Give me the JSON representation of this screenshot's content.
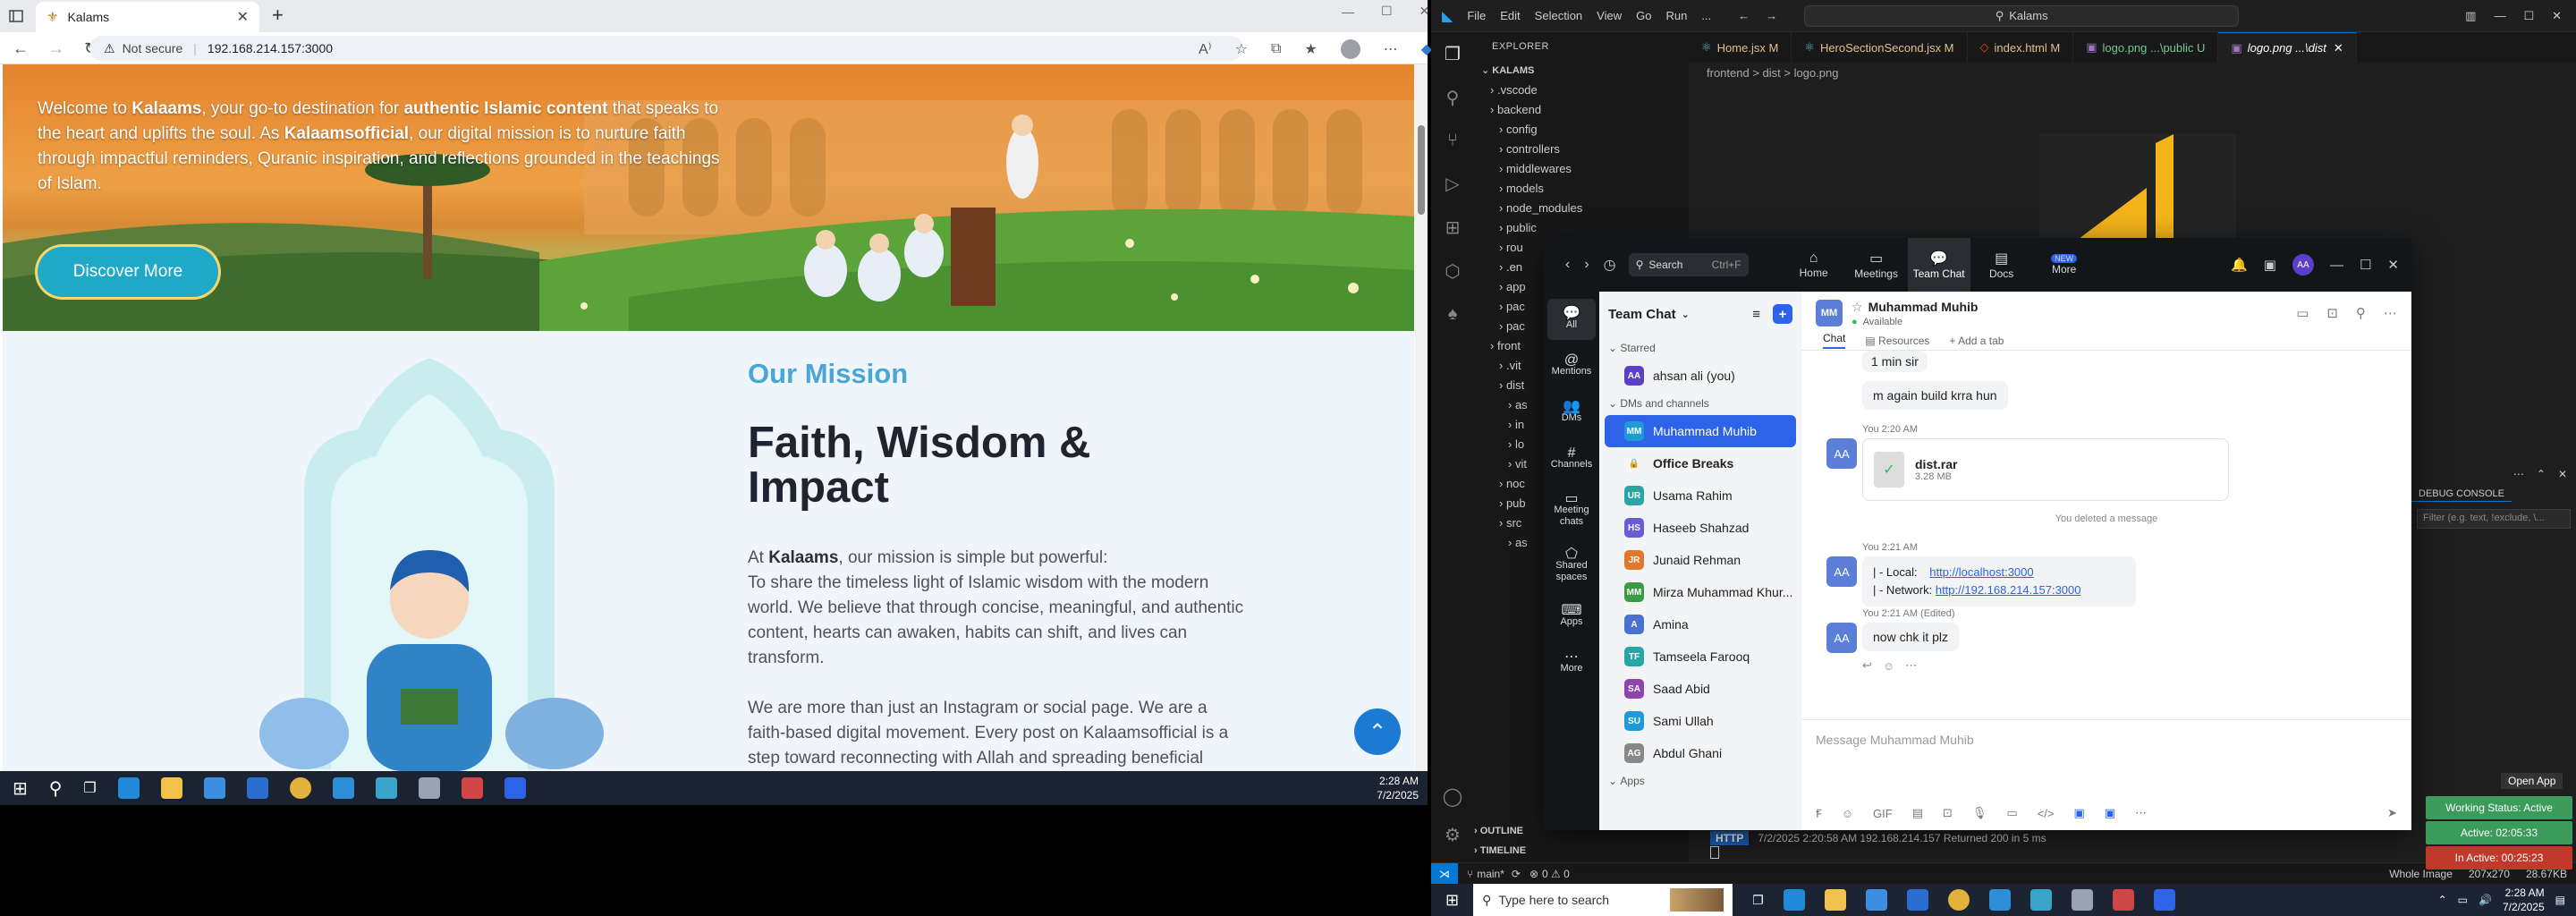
{
  "browser": {
    "tab_title": "Kalams",
    "security": "Not secure",
    "url": "192.168.214.157:3000"
  },
  "hero": {
    "text_pre": "Welcome to ",
    "text_b1": "Kalaams",
    "text_mid": ", your go-to destination for ",
    "text_b2": "authentic Islamic content",
    "text_mid2": " that speaks to the heart and uplifts the soul. As ",
    "text_b3": "Kalaamsofficial",
    "text_post": ", our digital mission is to nurture faith through impactful reminders, Quranic inspiration, and reflections grounded in the teachings of Islam.",
    "button": "Discover More"
  },
  "mission": {
    "label": "Our Mission",
    "title": "Faith, Wisdom & Impact",
    "p1_pre": "At ",
    "p1_b": "Kalaams",
    "p1_post": ", our mission is simple but powerful:",
    "p1_line2": "To share the timeless light of Islamic wisdom with the modern world. We believe that through concise, meaningful, and authentic content, hearts can awaken, habits can shift, and lives can transform.",
    "p2": "We are more than just an Instagram or social page. We are a faith-based digital movement. Every post on Kalaamsofficial is a step toward reconnecting with Allah and spreading beneficial"
  },
  "taskbar_left": {
    "time": "2:28 AM",
    "date": "7/2/2025"
  },
  "vscode": {
    "menu": [
      "File",
      "Edit",
      "Selection",
      "View",
      "Go",
      "Run",
      "..."
    ],
    "search": "Kalams",
    "explorer_title": "EXPLORER",
    "project": "KALAMS",
    "tree": [
      ".vscode",
      "backend",
      "config",
      "controllers",
      "middlewares",
      "models",
      "node_modules",
      "public",
      "rou",
      ".en",
      "app",
      "pac",
      "pac",
      "front",
      ".vit",
      "dist",
      "as",
      "in",
      "lo",
      "vit",
      "noc",
      "pub",
      "src",
      "as"
    ],
    "tabs": [
      "Home.jsx M",
      "HeroSectionSecond.jsx M",
      "index.html M",
      "logo.png ...\\public U",
      "logo.png ...\\dist"
    ],
    "breadcrumb": "frontend > dist > logo.png",
    "outline": "OUTLINE",
    "timeline": "TIMELINE",
    "branch": "main*",
    "problems": "0 ⚠ 0",
    "status_right": "Whole Image",
    "status_size": "207x270",
    "status_kb": "28.67KB",
    "debug_console": "DEBUG CONSOLE",
    "filter_placeholder": "Filter (e.g. text, !exclude, \\...",
    "terminal_line": "7/2/2025 2:20:58 AM 192.168.214.157 Returned 200 in 5 ms",
    "terminal_badge": "HTTP"
  },
  "zoom": {
    "search": "Search",
    "search_shortcut": "Ctrl+F",
    "nav": [
      "Home",
      "Meetings",
      "Team Chat",
      "Docs",
      "More"
    ],
    "new_badge": "NEW",
    "left": [
      "All",
      "Mentions",
      "DMs",
      "Channels",
      "Meeting chats",
      "Shared spaces",
      "Apps",
      "More"
    ],
    "panel_title": "Team Chat",
    "starred": "Starred",
    "dms": "DMs and channels",
    "apps": "Apps",
    "me": "ahsan ali (you)",
    "contacts": [
      {
        "name": "Muhammad Muhib",
        "initials": "MM",
        "color": "#1e9bd7"
      },
      {
        "name": "Office Breaks",
        "initials": "",
        "color": "#555"
      },
      {
        "name": "Usama Rahim",
        "initials": "UR",
        "color": "#2aa5a5"
      },
      {
        "name": "Haseeb Shahzad",
        "initials": "HS",
        "color": "#6b5bd6"
      },
      {
        "name": "Junaid Rehman",
        "initials": "JR",
        "color": "#e0772a"
      },
      {
        "name": "Mirza Muhammad Khur...",
        "initials": "MM",
        "color": "#3a9b45"
      },
      {
        "name": "Amina",
        "initials": "A",
        "color": "#4a70d0"
      },
      {
        "name": "Tamseela Farooq",
        "initials": "TF",
        "color": "#2aa5a5"
      },
      {
        "name": "Saad Abid",
        "initials": "SA",
        "color": "#8e44ad"
      },
      {
        "name": "Sami Ullah",
        "initials": "SU",
        "color": "#1e9bd7"
      },
      {
        "name": "Abdul Ghani",
        "initials": "AG",
        "color": "#888"
      }
    ],
    "chat_name": "Muhammad Muhib",
    "chat_status": "Available",
    "chat_tabs": [
      "Chat",
      "Resources",
      "Add a tab"
    ],
    "msg1": "1 min sir",
    "msg2": "m again build krra hun",
    "you_1": "You 2:20 AM",
    "file_name": "dist.rar",
    "file_size": "3.28 MB",
    "deleted": "You deleted a message",
    "you_2": "You 2:21 AM",
    "local_label": "|   - Local:",
    "local_url": "http://localhost:3000",
    "network_label": "|   - Network:",
    "network_url": "http://192.168.214.157:3000",
    "you_3": "You 2:21 AM (Edited)",
    "msg_last": "now chk it plz",
    "placeholder": "Message Muhammad Muhib",
    "my_initials": "AA"
  },
  "timers": {
    "open_app": "Open App",
    "status": "Working Status: Active",
    "active": "Active: 02:05:33",
    "inactive": "In Active: 00:25:23"
  },
  "taskbar_right": {
    "search": "Type here to search",
    "time": "2:28 AM",
    "date": "7/2/2025"
  }
}
